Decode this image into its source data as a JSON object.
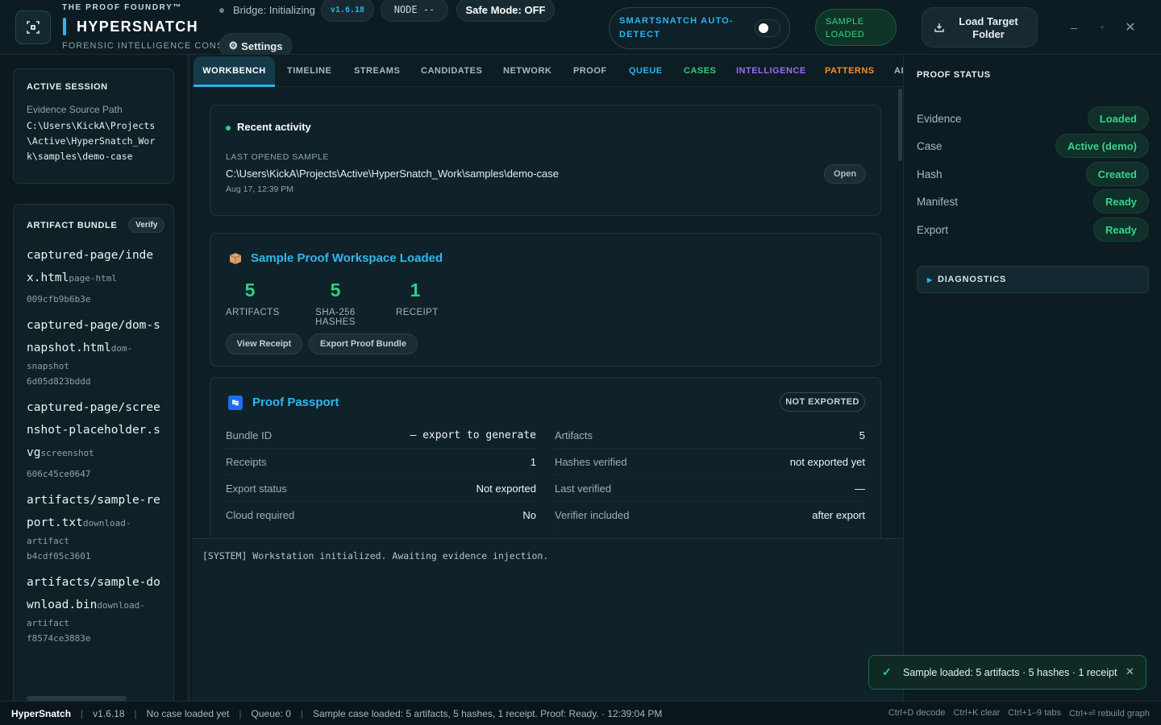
{
  "header": {
    "brand_top": "THE PROOF FOUNDRY™",
    "brand_main": "HYPERSNATCH",
    "brand_sub": "FORENSIC INTELLIGENCE CONSOLE",
    "bridge_status": "Bridge: Initializing",
    "version_chip": "v1.6.18",
    "node_chip": "NODE --",
    "safe_mode": "Safe Mode: OFF",
    "settings_label": "Settings",
    "auto_detect_label": "SMARTSNATCH AUTO-DETECT",
    "auto_detect_on": false,
    "sample_loaded": "SAMPLE LOADED",
    "load_target_label": "Load Target Folder",
    "window_controls": [
      "–",
      "▫",
      "✕"
    ]
  },
  "session": {
    "heading": "ACTIVE SESSION",
    "source_label": "Evidence Source Path",
    "source_path": "C:\\Users\\KickA\\Projects\\Active\\HyperSnatch_Work\\samples\\demo-case"
  },
  "bundle": {
    "heading": "ARTIFACT BUNDLE",
    "verify_label": "Verify",
    "artifacts": [
      {
        "name": "captured-page/index.html",
        "type": "page-html",
        "hash": "009cfb9b6b3e"
      },
      {
        "name": "captured-page/dom-snapshot.html",
        "type": "dom-snapshot",
        "hash": "6d05d823bddd"
      },
      {
        "name": "captured-page/screenshot-placeholder.svg",
        "type": "screenshot",
        "hash": "606c45ce0647"
      },
      {
        "name": "artifacts/sample-report.txt",
        "type": "download-artifact",
        "hash": "b4cdf05c3601"
      },
      {
        "name": "artifacts/sample-download.bin",
        "type": "download-artifact",
        "hash": "f8574ce3883e"
      }
    ]
  },
  "tabs": [
    {
      "label": "WORKBENCH",
      "color": "#ffffff",
      "active": true
    },
    {
      "label": "TIMELINE",
      "color": "#a9b8bd"
    },
    {
      "label": "STREAMS",
      "color": "#a9b8bd"
    },
    {
      "label": "CANDIDATES",
      "color": "#a9b8bd"
    },
    {
      "label": "NETWORK",
      "color": "#a9b8bd"
    },
    {
      "label": "PROOF",
      "color": "#a9b8bd"
    },
    {
      "label": "QUEUE",
      "color": "#2bb3ea"
    },
    {
      "label": "CASES",
      "color": "#35c97c"
    },
    {
      "label": "INTELLIGENCE",
      "color": "#9b6cf0"
    },
    {
      "label": "PATTERNS",
      "color": "#f0902d"
    },
    {
      "label": "AI",
      "color": "#a9b8bd"
    }
  ],
  "recent": {
    "title": "Recent activity",
    "label": "LAST OPENED SAMPLE",
    "path": "C:\\Users\\KickA\\Projects\\Active\\HyperSnatch_Work\\samples\\demo-case",
    "time": "Aug 17, 12:39 PM",
    "open_label": "Open"
  },
  "workspace": {
    "title": "Sample Proof Workspace Loaded",
    "stats": {
      "artifacts": {
        "value": "5",
        "label": "ARTIFACTS"
      },
      "hashes": {
        "value": "5",
        "label": "SHA-256 HASHES"
      },
      "receipt": {
        "value": "1",
        "label": "RECEIPT"
      }
    },
    "view_receipt_label": "View Receipt",
    "export_bundle_label": "Export Proof Bundle"
  },
  "passport": {
    "icon_text": "↹",
    "title": "Proof Passport",
    "badge": "NOT EXPORTED",
    "left": [
      {
        "key": "Bundle ID",
        "value": "— export to generate",
        "mono": true
      },
      {
        "key": "Receipts",
        "value": "1"
      },
      {
        "key": "Export status",
        "value": "Not exported"
      },
      {
        "key": "Cloud required",
        "value": "No"
      }
    ],
    "right": [
      {
        "key": "Artifacts",
        "value": "5"
      },
      {
        "key": "Hashes verified",
        "value": "not exported yet"
      },
      {
        "key": "Last verified",
        "value": "—"
      },
      {
        "key": "Verifier included",
        "value": "after export"
      }
    ]
  },
  "console": {
    "line": "[SYSTEM] Workstation initialized. Awaiting evidence injection."
  },
  "proof_status": {
    "title": "PROOF STATUS",
    "rows": [
      {
        "key": "Evidence",
        "value": "Loaded"
      },
      {
        "key": "Case",
        "value": "Active (demo)"
      },
      {
        "key": "Hash",
        "value": "Created"
      },
      {
        "key": "Manifest",
        "value": "Ready"
      },
      {
        "key": "Export",
        "value": "Ready"
      }
    ],
    "diagnostics_label": "DIAGNOSTICS"
  },
  "toast": {
    "check": "✓",
    "text": "Sample loaded: 5 artifacts · 5 hashes · 1 receipt",
    "close": "✕"
  },
  "statusbar": {
    "app": "HyperSnatch",
    "version": "v1.6.18",
    "case": "No case loaded yet",
    "queue": "Queue: 0",
    "message": "Sample case loaded: 5 artifacts, 5 hashes, 1 receipt. Proof: Ready. · 12:39:04 PM",
    "hints": [
      "Ctrl+D decode",
      "Ctrl+K clear",
      "Ctrl+1–9 tabs",
      "Ctrl+⏎ rebuild graph"
    ]
  },
  "colors": {
    "accent_blue": "#2bb3ea",
    "accent_green": "#2fd082",
    "background": "#0c1a20"
  }
}
